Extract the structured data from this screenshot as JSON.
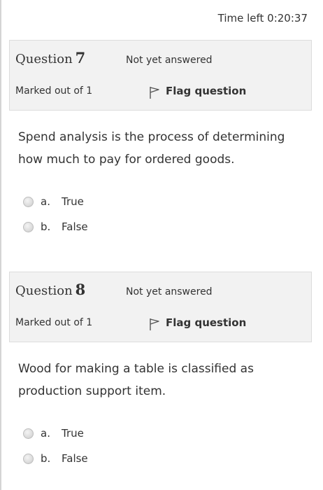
{
  "timer": {
    "label": "Time left 0:20:37"
  },
  "questions": [
    {
      "prefix": "Question",
      "number": "7",
      "state": "Not yet answered",
      "grade": "Marked out of 1",
      "flag_label": "Flag question",
      "text": "Spend analysis is the process of determining how much to pay for ordered goods.",
      "answers": [
        {
          "letter": "a.",
          "label": "True"
        },
        {
          "letter": "b.",
          "label": "False"
        }
      ]
    },
    {
      "prefix": "Question",
      "number": "8",
      "state": "Not yet answered",
      "grade": "Marked out of 1",
      "flag_label": "Flag question",
      "text": "Wood for making a table is classified as production support item.",
      "answers": [
        {
          "letter": "a.",
          "label": "True"
        },
        {
          "letter": "b.",
          "label": "False"
        }
      ]
    }
  ],
  "colors": {
    "info_box_bg": "#f2f2f2",
    "info_box_border": "#dcdcdc",
    "text": "#333333"
  },
  "icons": {
    "flag": "flag-icon",
    "radio": "radio-unchecked-icon"
  }
}
